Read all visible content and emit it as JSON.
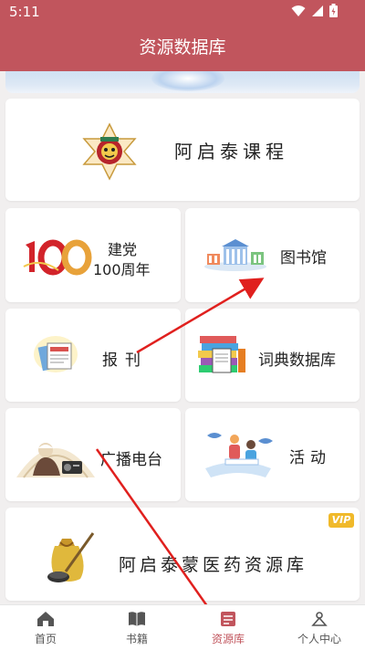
{
  "status_bar": {
    "time": "5:11"
  },
  "header": {
    "title": "资源数据库"
  },
  "cards": {
    "course": "阿启泰课程",
    "party_line1": "建党",
    "party_line2": "100周年",
    "library": "图书馆",
    "journal": "报刊",
    "dictionary": "词典数据库",
    "radio": "广播电台",
    "activity": "活动",
    "medicine": "阿启泰蒙医药资源库",
    "vip_badge": "VIP"
  },
  "tabbar": {
    "items": [
      {
        "label": "首页",
        "icon": "home-icon"
      },
      {
        "label": "书籍",
        "icon": "book-icon"
      },
      {
        "label": "资源库",
        "icon": "database-icon"
      },
      {
        "label": "个人中心",
        "icon": "person-icon"
      }
    ],
    "active_index": 2
  },
  "colors": {
    "header": "#c1555d",
    "accent": "#c1555d",
    "background": "#f1efef"
  }
}
